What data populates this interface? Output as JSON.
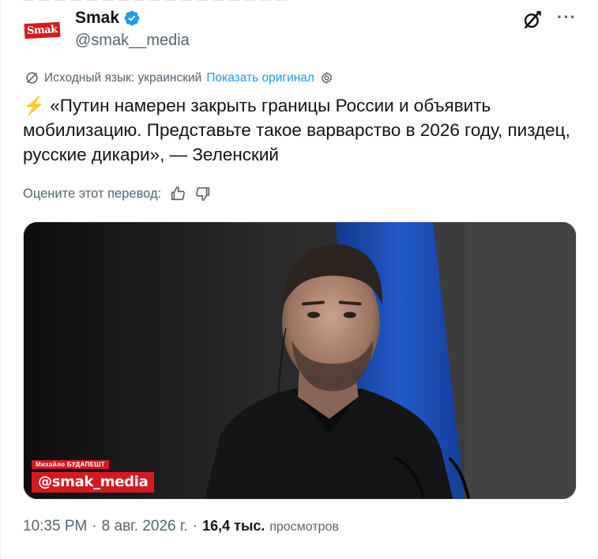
{
  "author": {
    "display_name": "Smak",
    "handle": "@smak__media",
    "avatar_text": "Smak"
  },
  "translation": {
    "source_label": "Исходный язык: украинский",
    "show_original": "Показать оригинал"
  },
  "tweet": {
    "emoji": "⚡",
    "text": "«Путин намерен закрыть границы России и объявить мобилизацию. Представьте такое варварство в 2026 году, пиздец, русские дикари», — Зеленский"
  },
  "rating": {
    "label": "Оцените этот перевод:"
  },
  "media": {
    "caption_small": "Михайло БУДАПЕШТ",
    "watermark": "@smak_media"
  },
  "meta": {
    "time": "10:35 PM",
    "sep1": "·",
    "date": "8 авг. 2026 г.",
    "sep2": "·",
    "views_count": "16,4 тыс.",
    "views_word": "просмотров"
  },
  "colors": {
    "accent": "#1d9bf0",
    "muted": "#536471",
    "brand_red": "#d7191f",
    "flag_blue": "#1f4fb3"
  },
  "icons": [
    "verified-badge-icon",
    "grok-icon",
    "more-icon",
    "translate-icon",
    "settings-icon",
    "thumbs-up-icon",
    "thumbs-down-icon"
  ]
}
